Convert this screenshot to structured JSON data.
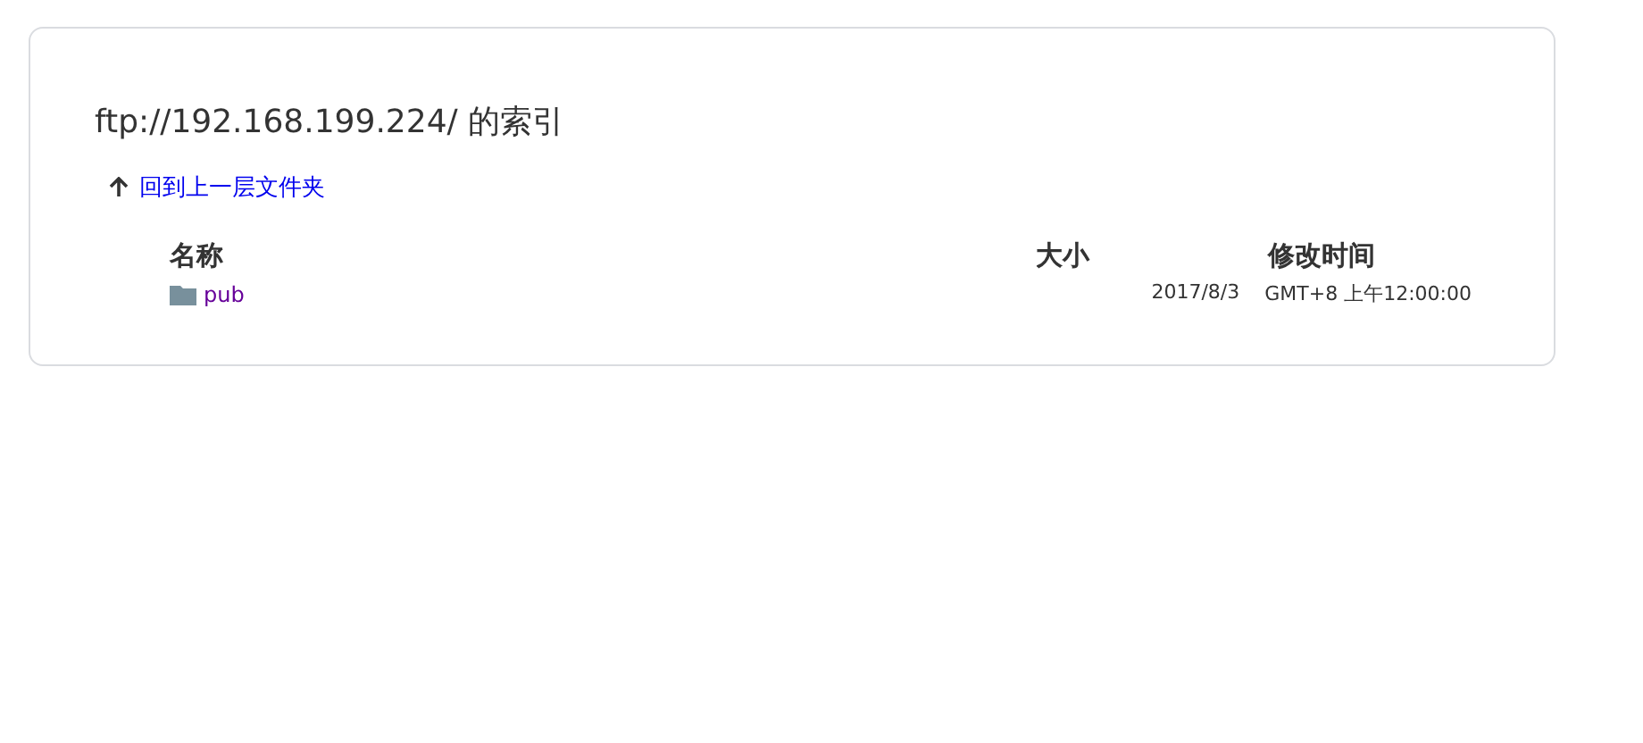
{
  "title": "ftp://192.168.199.224/ 的索引",
  "parent_link": {
    "label": "回到上一层文件夹"
  },
  "table": {
    "columns": [
      "名称",
      "大小",
      "修改时间"
    ],
    "rows": [
      {
        "kind": "folder",
        "name": "pub",
        "date": "2017/8/3",
        "time": "GMT+8 上午12:00:00"
      }
    ]
  }
}
